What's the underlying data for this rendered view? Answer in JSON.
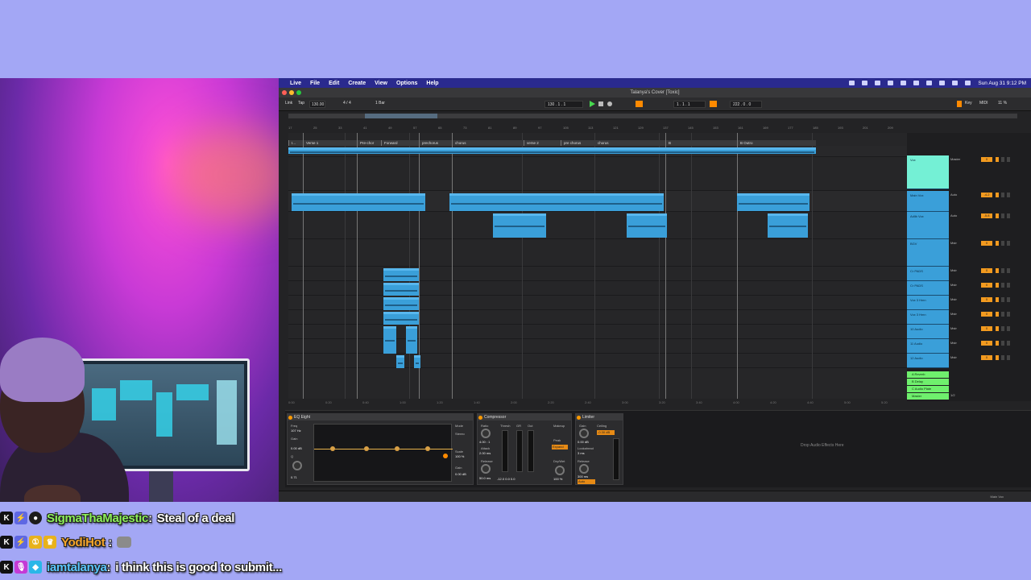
{
  "daw": {
    "app_menu": "Live",
    "menus": [
      "File",
      "Edit",
      "Create",
      "View",
      "Options",
      "Help"
    ],
    "clock": "Sun Aug 31  9:12 PM",
    "window_title": "Talanya's Cover  [Toxic]",
    "transport": {
      "link": "Link",
      "tap": "Tap",
      "tempo": "130.00",
      "time_sig": "4 / 4",
      "quantize": "1 Bar",
      "position": "130 .  1 .  1",
      "loop_start": "1 .  1 .  1",
      "loop_length": "222 .  0 .  0",
      "key": "Key",
      "midi": "MIDI",
      "cpu": "11 %"
    },
    "ruler": [
      "17",
      "25",
      "33",
      "41",
      "49",
      "57",
      "65",
      "73",
      "81",
      "89",
      "97",
      "105",
      "113",
      "121",
      "129",
      "137",
      "145",
      "153",
      "161",
      "169",
      "177",
      "185",
      "193",
      "201",
      "209"
    ],
    "locators": [
      "I...",
      "Verse 1",
      "Pre-chor",
      "Forward",
      "prechorus",
      "chorus",
      "verse 2",
      "pre chorus",
      "chorus",
      "B",
      "B Outro"
    ],
    "times": [
      "0:00",
      "0:20",
      "0:40",
      "1:00",
      "1:20",
      "1:40",
      "2:00",
      "2:20",
      "2:40",
      "3:00",
      "3:20",
      "3:40",
      "4:00",
      "4:20",
      "4:40",
      "5:00",
      "5:20"
    ],
    "tracks": [
      {
        "name": "Vox",
        "io": "Master",
        "vol": "0"
      },
      {
        "name": "Main Vox",
        "io": "Auto",
        "vol": "-4.2"
      },
      {
        "name": "Adlib Vox",
        "io": "Auto",
        "vol": "-5.8"
      },
      {
        "name": "BGV",
        "io": "Mstr",
        "vol": "0"
      },
      {
        "name": "Cr PADS",
        "io": "Mstr",
        "vol": "0"
      },
      {
        "name": "Cr PADS",
        "io": "Mstr",
        "vol": "0"
      },
      {
        "name": "Vox 3 Hmn",
        "io": "Mstr",
        "vol": "0"
      },
      {
        "name": "Vox 3 Hmn",
        "io": "Mstr",
        "vol": "0"
      },
      {
        "name": "10 Audio",
        "io": "Mstr",
        "vol": "0"
      },
      {
        "name": "11 Audio",
        "io": "Mstr",
        "vol": "0"
      },
      {
        "name": "12 Audio",
        "io": "Mstr",
        "vol": "0"
      }
    ],
    "returns": [
      "A Reverb",
      "B Delay",
      "C Audio Plate",
      "Master"
    ],
    "master_label": "1/2",
    "devices": {
      "eq_title": "EQ Eight",
      "eq_labels": {
        "freq": "Freq",
        "gain": "Gain",
        "q": "Q",
        "mode": "Mode",
        "stereo": "Stereo",
        "scale": "Scale",
        "gain_out": "Gain"
      },
      "eq_values": {
        "freq": "107 Hz",
        "gain": "0.00 dB",
        "q": "0.71",
        "scale": "100 %",
        "gain_out": "0.00 dB"
      },
      "comp_title": "Compressor",
      "comp_labels": {
        "ratio": "Ratio",
        "attack": "Attack",
        "release": "Release",
        "thresh": "Thresh",
        "gr": "GR",
        "out": "Out",
        "makeup": "Makeup",
        "peak": "Peak",
        "expand": "Expand",
        "drywet": "Dry/Wet"
      },
      "comp_values": {
        "ratio": "4.00 : 1",
        "attack": "2.00 ms",
        "release": "50.0 ms",
        "gr_readout": "-12.0   0.0   0.0",
        "drywet": "100 %"
      },
      "lim_title": "Limiter",
      "lim_labels": {
        "gain": "Gain",
        "ceiling": "Ceiling",
        "lookahead": "Lookahead",
        "release": "Release",
        "auto": "Auto"
      },
      "lim_values": {
        "gain": "0.00 dB",
        "ceiling": "-0.30 dB",
        "lookahead": "3 ms",
        "release": "300 ms"
      },
      "drop_hint": "Drop Audio Effects Here"
    },
    "status_right": "Main Vox"
  },
  "chat": [
    {
      "user": "SigmaThaMajestic",
      "sep": ":",
      "message": "Steal of a deal",
      "color": "#8cf05a",
      "badges": [
        "K",
        "P",
        "R"
      ]
    },
    {
      "user": "YodiHot",
      "sep": ":",
      "message": "",
      "color": "#f5a52a",
      "badges": [
        "K",
        "P",
        "Y",
        "Y2"
      ],
      "has_emote": true
    },
    {
      "user": "iamtalanya",
      "sep": ":",
      "message": "i think this is good to submit...",
      "color": "#58c6ff",
      "badges": [
        "K",
        "M",
        "C"
      ]
    }
  ]
}
